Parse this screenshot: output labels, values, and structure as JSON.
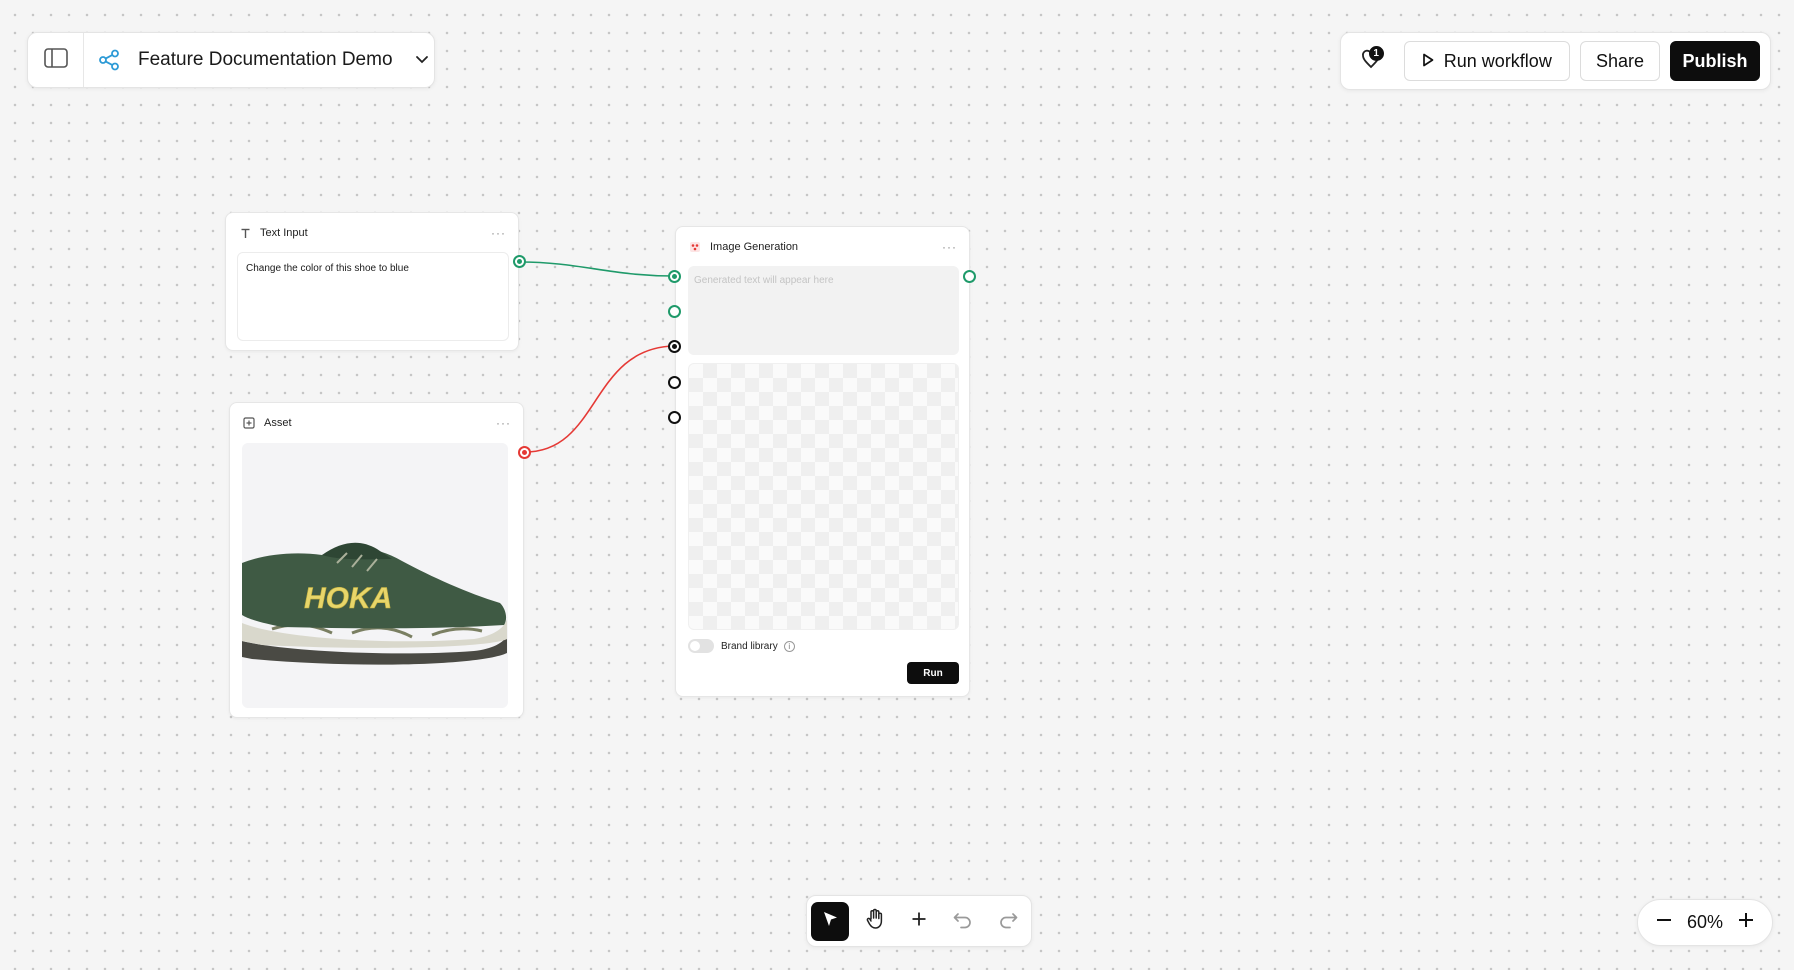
{
  "header": {
    "workflow_title": "Feature Documentation Demo"
  },
  "actions": {
    "notification_count": "1",
    "run_workflow_label": "Run workflow",
    "share_label": "Share",
    "publish_label": "Publish"
  },
  "nodes": {
    "text_input": {
      "title": "Text Input",
      "value": "Change the color of this shoe to blue"
    },
    "asset": {
      "title": "Asset",
      "image_brand": "HOKA"
    },
    "image_generation": {
      "title": "Image Generation",
      "placeholder": "Generated text will appear here",
      "brand_library_label": "Brand library",
      "run_label": "Run"
    }
  },
  "toolbar": {
    "tools": [
      "select-tool",
      "hand-tool",
      "add-tool",
      "undo",
      "redo"
    ]
  },
  "zoom": {
    "level": "60%"
  },
  "colors": {
    "accent_green": "#1f9a6a",
    "accent_red": "#e53935",
    "primary_dark": "#0d0d0d",
    "workflow_icon": "#2c9ad6"
  }
}
